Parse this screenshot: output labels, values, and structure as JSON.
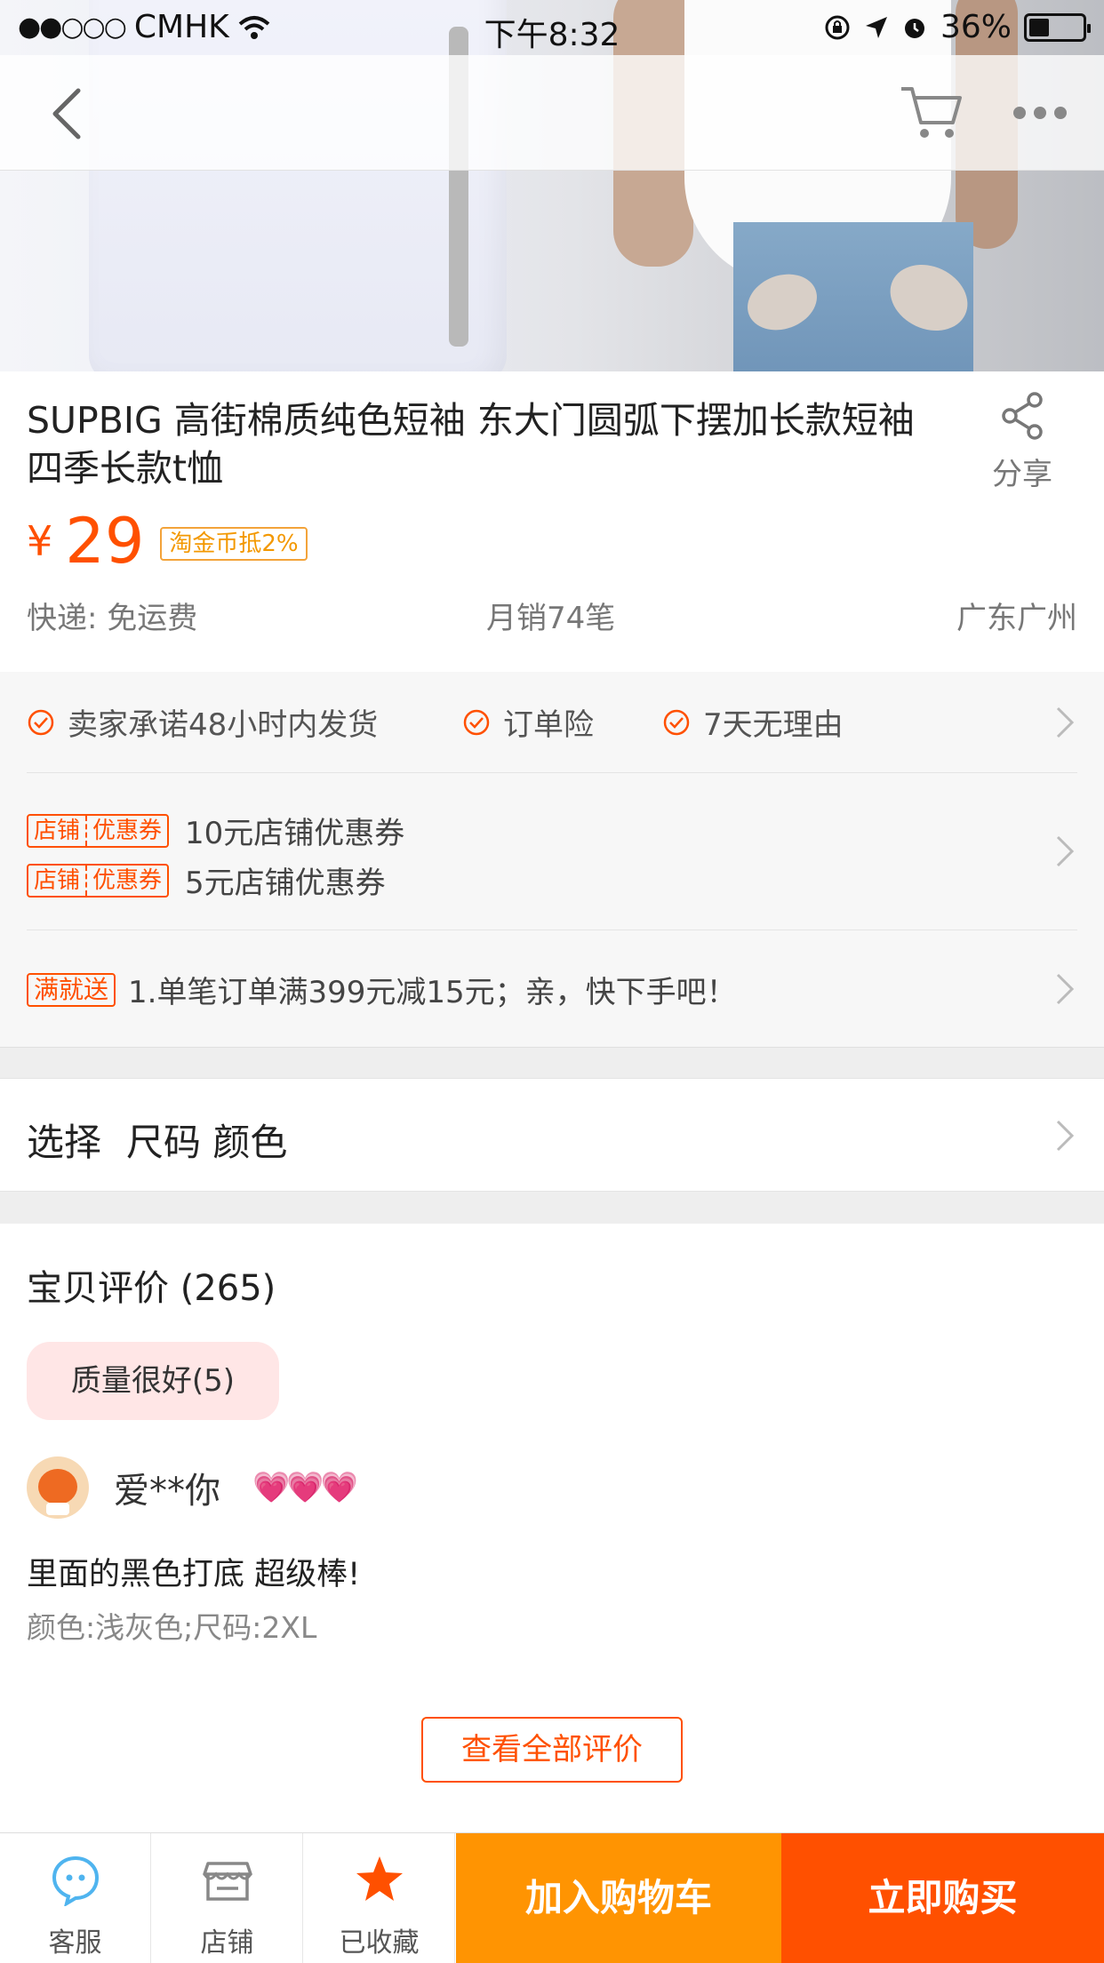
{
  "status_bar": {
    "signal": "●●○○○",
    "carrier": "CMHK",
    "time": "下午8:32",
    "battery": "36%"
  },
  "nav": {
    "back_icon": "chevron-left-icon",
    "cart_icon": "cart-icon",
    "more_icon": "more-dots-icon"
  },
  "product": {
    "title": "SUPBIG 高街棉质纯色短袖 东大门圆弧下摆加长款短袖四季长款t恤",
    "share_label": "分享",
    "currency": "¥",
    "price": "29",
    "coin_tag": "淘金币抵2%",
    "shipping": "快递: 免运费",
    "monthly_sales": "月销74笔",
    "location": "广东广州"
  },
  "services": {
    "promises": [
      "卖家承诺48小时内发货",
      "订单险",
      "7天无理由"
    ],
    "coupons": [
      {
        "tag_left": "店铺",
        "tag_right": "优惠券",
        "text": "10元店铺优惠券"
      },
      {
        "tag_left": "店铺",
        "tag_right": "优惠券",
        "text": "5元店铺优惠券"
      }
    ],
    "promo_tag": "满就送",
    "promo_text": "1.单笔订单满399元减15元；亲，快下手吧！"
  },
  "select": {
    "label": "选择",
    "options": "尺码 颜色"
  },
  "reviews": {
    "title": "宝贝评价",
    "count": "(265)",
    "tag": "质量很好(5)",
    "reviewer": "爱**你",
    "hearts": "💗💗💗",
    "text": "里面的黑色打底 超级棒!",
    "spec": "颜色:浅灰色;尺码:2XL",
    "view_all": "查看全部评价"
  },
  "bottom_bar": {
    "service": "客服",
    "shop": "店铺",
    "favorite": "已收藏",
    "add_cart": "加入购物车",
    "buy_now": "立即购买"
  },
  "colors": {
    "accent": "#ff5000",
    "cart_button": "#ff9402",
    "service_icon": "#4fb4ef"
  }
}
